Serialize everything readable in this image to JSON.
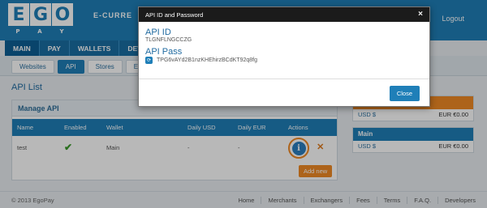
{
  "brand": {
    "logo_top": [
      "E",
      "G",
      "O"
    ],
    "logo_bottom": [
      "P",
      "A",
      "Y"
    ],
    "tagline": "E-CURRE",
    "primary_color": "#1f7fb8",
    "accent_color": "#f08a24"
  },
  "header": {
    "logout": "Logout"
  },
  "topnav": [
    "MAIN",
    "PAY",
    "WALLETS",
    "DEV"
  ],
  "subnav": [
    "Websites",
    "API",
    "Stores",
    "Expo"
  ],
  "main": {
    "title": "API List",
    "panel_title": "Manage API",
    "columns": [
      "Name",
      "Enabled",
      "Wallet",
      "Daily USD",
      "Daily EUR",
      "Actions"
    ],
    "rows": [
      {
        "name": "test",
        "enabled_icon": "check-icon",
        "wallet": "Main",
        "daily_usd": "-",
        "daily_eur": "-"
      }
    ],
    "add_new": "Add new"
  },
  "side": {
    "boxes": [
      {
        "title": "",
        "usd_label": "USD $",
        "eur_label": "EUR €0.00"
      },
      {
        "title": "Main",
        "usd_label": "USD $",
        "eur_label": "EUR €0.00"
      }
    ]
  },
  "footer": {
    "copyright": "© 2013 EgoPay",
    "links": [
      "Home",
      "Merchants",
      "Exchangers",
      "Fees",
      "Terms",
      "F.A.Q.",
      "Developers"
    ]
  },
  "modal": {
    "title": "API ID and Password",
    "close_symbol": "×",
    "api_id_label": "API ID",
    "api_id_value": "TLGNFLNGCCZG",
    "api_pass_label": "API Pass",
    "api_pass_value": "TPG6vAYd2B1nzKHEhirzBCdKT92q8fg",
    "close_button": "Close"
  }
}
